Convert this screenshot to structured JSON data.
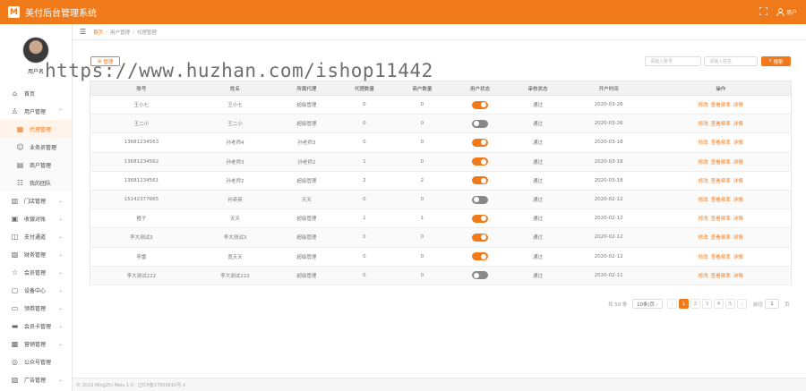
{
  "app": {
    "logo_letter": "M",
    "title": "美付后台管理系统",
    "user_label": "用户"
  },
  "sidebar": {
    "user_name": "用户名",
    "items": [
      {
        "icon": "home-icon",
        "label": "首页",
        "type": "top",
        "arrow": ""
      },
      {
        "icon": "user-icon",
        "label": "用户管理",
        "type": "top",
        "arrow": "⌃"
      },
      {
        "icon": "agent-icon",
        "label": "代理管理",
        "type": "sub-active",
        "arrow": ""
      },
      {
        "icon": "salesman-icon",
        "label": "业务员管理",
        "type": "sub",
        "arrow": ""
      },
      {
        "icon": "merchant-icon",
        "label": "商户管理",
        "type": "sub",
        "arrow": ""
      },
      {
        "icon": "team-icon",
        "label": "我的团队",
        "type": "sub",
        "arrow": ""
      },
      {
        "icon": "store-icon",
        "label": "门店管理",
        "type": "top",
        "arrow": "⌄"
      },
      {
        "icon": "reconcile-icon",
        "label": "收银对账",
        "type": "top",
        "arrow": "⌄"
      },
      {
        "icon": "payment-icon",
        "label": "支付通道",
        "type": "top",
        "arrow": "⌄"
      },
      {
        "icon": "finance-icon",
        "label": "财务管理",
        "type": "top",
        "arrow": "⌄"
      },
      {
        "icon": "member-icon",
        "label": "会员管理",
        "type": "top",
        "arrow": "⌄"
      },
      {
        "icon": "device-icon",
        "label": "设备中心",
        "type": "top",
        "arrow": "⌄"
      },
      {
        "icon": "coupon-icon",
        "label": "领券管理",
        "type": "top",
        "arrow": "⌄"
      },
      {
        "icon": "card-icon",
        "label": "会员卡管理",
        "type": "top",
        "arrow": "⌄"
      },
      {
        "icon": "marketing-icon",
        "label": "营销管理",
        "type": "top",
        "arrow": "⌄"
      },
      {
        "icon": "wechat-icon",
        "label": "公众号管理",
        "type": "top",
        "arrow": ""
      },
      {
        "icon": "ad-icon",
        "label": "广告管理",
        "type": "top",
        "arrow": "⌄"
      }
    ]
  },
  "breadcrumb": {
    "home": "首页",
    "level1": "用户管理",
    "level2": "代理管理"
  },
  "toolbar": {
    "add_label": "管理",
    "account_placeholder": "请输入账号",
    "name_placeholder": "请输入姓名",
    "search_label": "搜索"
  },
  "table": {
    "headers": [
      "账号",
      "姓名",
      "所属代理",
      "代理数量",
      "商户数量",
      "用户状态",
      "审核状态",
      "开户时间",
      "操作"
    ],
    "rows": [
      {
        "account": "王小七",
        "name": "王小七",
        "parent": "超级管理",
        "agents": "0",
        "merchants": "0",
        "status_on": true,
        "audit": "通过",
        "opened": "2020-03-26"
      },
      {
        "account": "王二小",
        "name": "王二小",
        "parent": "超级管理",
        "agents": "0",
        "merchants": "0",
        "status_on": false,
        "audit": "通过",
        "opened": "2020-03-26"
      },
      {
        "account": "13681234563",
        "name": "孙老师4",
        "parent": "孙老师3",
        "agents": "0",
        "merchants": "0",
        "status_on": true,
        "audit": "通过",
        "opened": "2020-03-18"
      },
      {
        "account": "13681234562",
        "name": "孙老师3",
        "parent": "孙老师2",
        "agents": "1",
        "merchants": "0",
        "status_on": true,
        "audit": "通过",
        "opened": "2020-03-18"
      },
      {
        "account": "13681234561",
        "name": "孙老师2",
        "parent": "超级管理",
        "agents": "2",
        "merchants": "2",
        "status_on": true,
        "audit": "通过",
        "opened": "2020-03-18"
      },
      {
        "account": "15142377665",
        "name": "孙英英",
        "parent": "天天",
        "agents": "0",
        "merchants": "0",
        "status_on": false,
        "audit": "通过",
        "opened": "2020-02-12"
      },
      {
        "account": "橙子",
        "name": "天天",
        "parent": "超级管理",
        "agents": "1",
        "merchants": "1",
        "status_on": true,
        "audit": "通过",
        "opened": "2020-02-12"
      },
      {
        "account": "李大测试3",
        "name": "李大测试3",
        "parent": "超级管理",
        "agents": "0",
        "merchants": "0",
        "status_on": true,
        "audit": "通过",
        "opened": "2020-02-12"
      },
      {
        "account": "亭雷",
        "name": "宽天天",
        "parent": "超级管理",
        "agents": "0",
        "merchants": "0",
        "status_on": true,
        "audit": "通过",
        "opened": "2020-02-12"
      },
      {
        "account": "李大测试222",
        "name": "李大测试222",
        "parent": "超级管理",
        "agents": "0",
        "merchants": "0",
        "status_on": false,
        "audit": "通过",
        "opened": "2020-02-11"
      }
    ],
    "ops": [
      "修改",
      "查看费率",
      "详情"
    ]
  },
  "pagination": {
    "total": "共 50 条",
    "page_size": "10条/页",
    "prev": "‹",
    "pages": [
      "1",
      "2",
      "3",
      "4",
      "5"
    ],
    "next": "›",
    "goto_label": "前往",
    "goto_value": "1",
    "page_unit": "页"
  },
  "footer": {
    "text": "© 2019 MingZhi Meiu 1.0 · 辽ICP备17000810号-3"
  },
  "watermark": {
    "text": "https://www.huzhan.com/ishop11442"
  },
  "colors": {
    "accent": "#f07a1a",
    "success": "#4caf50"
  }
}
